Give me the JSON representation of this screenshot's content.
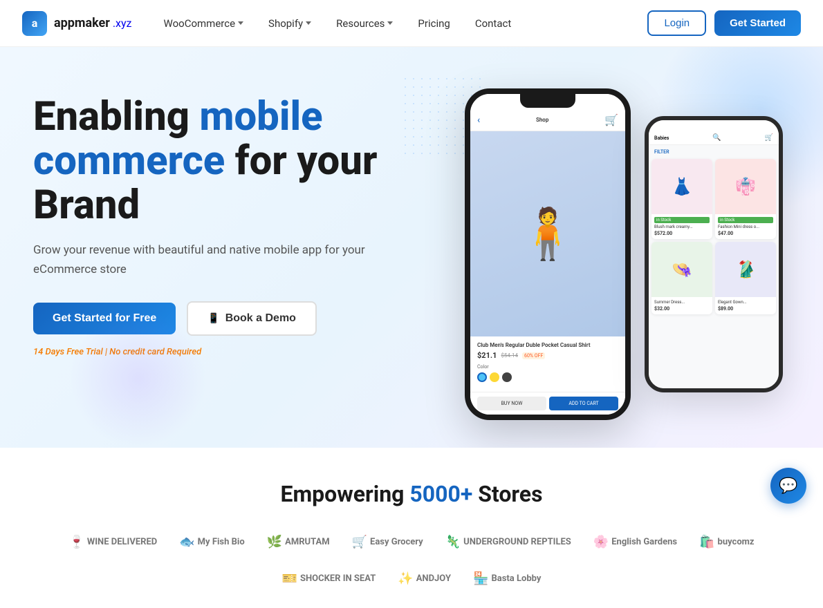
{
  "brand": {
    "name": "appmaker",
    "tagline": ".xyz",
    "logo_letter": "a"
  },
  "nav": {
    "items": [
      {
        "label": "WooCommerce",
        "has_dropdown": true
      },
      {
        "label": "Shopify",
        "has_dropdown": true
      },
      {
        "label": "Resources",
        "has_dropdown": true
      },
      {
        "label": "Pricing",
        "has_dropdown": false
      },
      {
        "label": "Contact",
        "has_dropdown": false
      }
    ],
    "login_label": "Login",
    "get_started_label": "Get Started"
  },
  "hero": {
    "title_line1": "Enabling ",
    "title_highlight": "mobile",
    "title_line2": "commerce",
    "title_line3": " for your",
    "title_line4": "Brand",
    "subtitle": "Grow your revenue with beautiful and native mobile app for your eCommerce store",
    "cta_primary": "Get Started for Free",
    "cta_secondary": "Book a Demo",
    "trial_note": "14 Days Free Trial | No credit card Required"
  },
  "partners": {
    "title_prefix": "Empowering ",
    "title_count": "5000+",
    "title_suffix": " Stores",
    "logos": [
      {
        "name": "WINE DELIVERED",
        "emoji": "🍷"
      },
      {
        "name": "My Fish Bio",
        "emoji": "🐟"
      },
      {
        "name": "AMRUTAM",
        "emoji": "🌿"
      },
      {
        "name": "Easy Grocery",
        "emoji": "🛒"
      },
      {
        "name": "UNDERGROUND REPTILES",
        "emoji": "🦎"
      },
      {
        "name": "English Gardens",
        "emoji": "🌸"
      },
      {
        "name": "buycomz",
        "emoji": "🛍️"
      },
      {
        "name": "SHOCKER IN SEAT",
        "emoji": "🎫"
      },
      {
        "name": "ANDJOY",
        "emoji": "✨"
      },
      {
        "name": "Basta Lobby",
        "emoji": "🏪"
      }
    ]
  },
  "product_demo": {
    "price": "$21.1",
    "price_original": "$54.14",
    "price_off": "60% OFF",
    "product_name": "Club Men's Regular Duble Pocket Casual Shirt",
    "color_label": "Color",
    "btn_buy": "BUY NOW",
    "btn_add": "ADD TO CART",
    "category_babies": "Babies",
    "filter_label": "FILTER"
  },
  "chat": {
    "icon": "💬"
  }
}
